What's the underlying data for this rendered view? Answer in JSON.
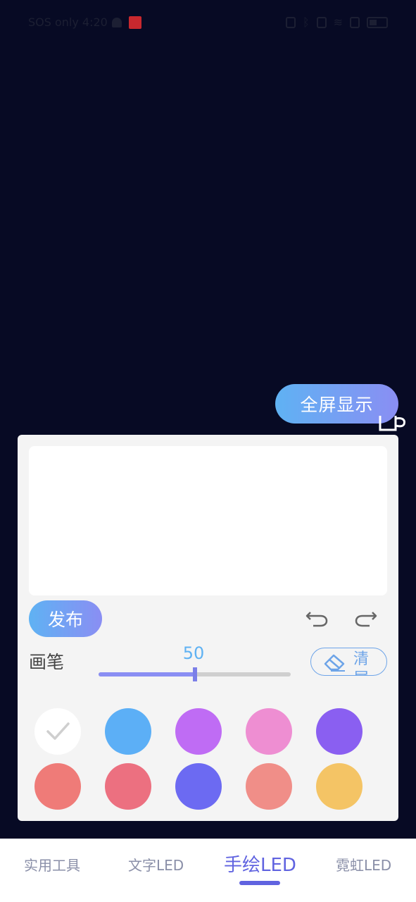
{
  "status_bar": {
    "left_text": "SOS only 4:20",
    "icons": [
      "bell-icon",
      "app-badge-icon",
      "nfc-icon",
      "bluetooth-icon",
      "vibrate-icon",
      "wifi-icon",
      "sim-icon",
      "battery-icon"
    ]
  },
  "fullscreen_button": {
    "label": "全屏显示"
  },
  "drawing_panel": {
    "publish_label": "发布",
    "brush_label": "画笔",
    "brush_size": "50",
    "brush_size_fraction": 0.5,
    "clear_label": "清屏",
    "colors": [
      {
        "hex": "#ffffff",
        "selected": true
      },
      {
        "hex": "#5caff6",
        "selected": false
      },
      {
        "hex": "#bf6cf4",
        "selected": false
      },
      {
        "hex": "#ee8ed2",
        "selected": false
      },
      {
        "hex": "#8a5ff1",
        "selected": false
      },
      {
        "hex": "#ef7b78",
        "selected": false
      },
      {
        "hex": "#ec7080",
        "selected": false
      },
      {
        "hex": "#6c6af2",
        "selected": false
      },
      {
        "hex": "#f08e88",
        "selected": false
      },
      {
        "hex": "#f4c465",
        "selected": false
      }
    ]
  },
  "bottom_nav": {
    "tabs": [
      {
        "label": "实用工具",
        "active": false
      },
      {
        "label": "文字LED",
        "active": false
      },
      {
        "label": "手绘LED",
        "active": true
      },
      {
        "label": "霓虹LED",
        "active": false
      }
    ]
  },
  "theme": {
    "background": "#070A24",
    "accent": "#6063e0",
    "gradient_start": "#5fb2f3",
    "gradient_end": "#8a8ef3"
  }
}
